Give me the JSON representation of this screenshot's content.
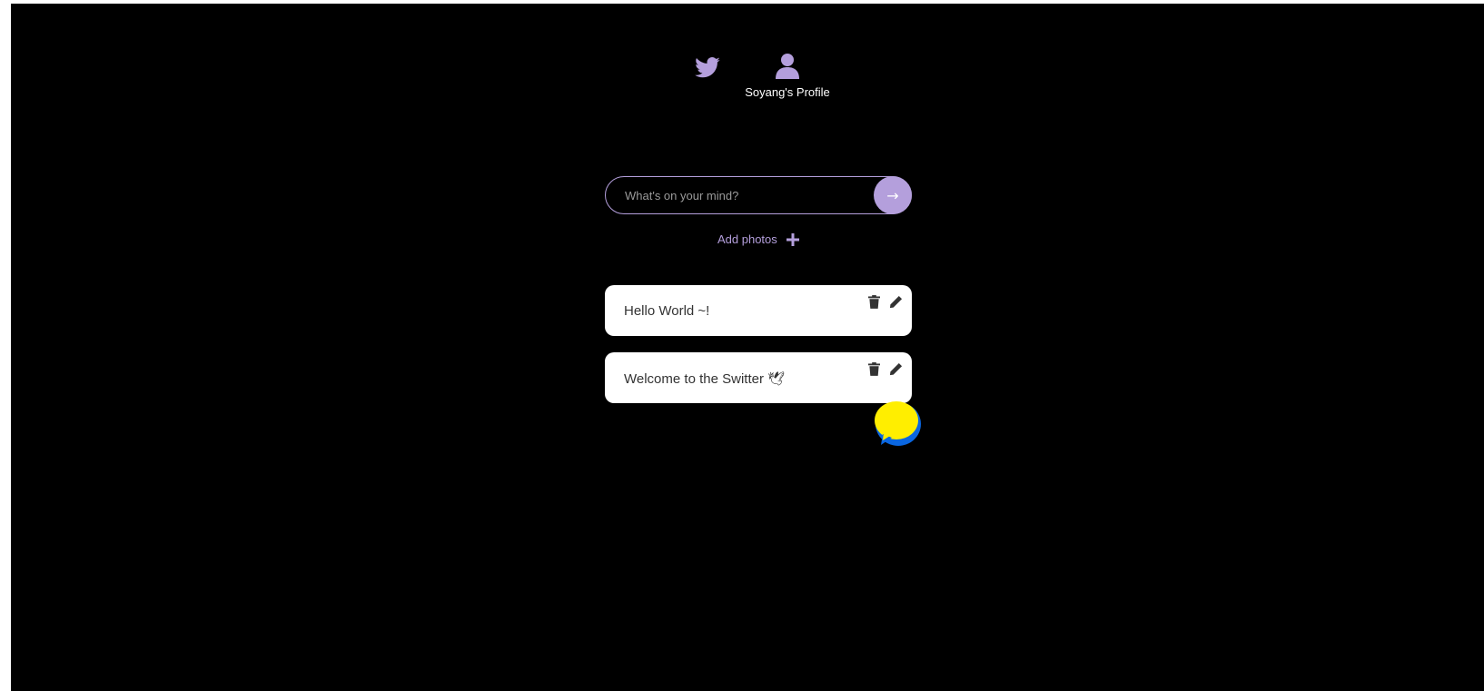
{
  "nav": {
    "home_icon": "twitter-bird-icon",
    "profile_icon": "user-icon",
    "profile_label": "Soyang's Profile"
  },
  "composer": {
    "placeholder": "What's on your mind?",
    "value": "",
    "submit_label": "→"
  },
  "add_photos": {
    "label": "Add photos",
    "icon": "plus-icon"
  },
  "tweets": [
    {
      "text": "Hello World ~!"
    },
    {
      "text": "Welcome to the Switter 🕊"
    }
  ],
  "colors": {
    "accent": "#b49fdc",
    "background": "#000000",
    "card": "#ffffff",
    "chat_bubble": "#ffee00",
    "chat_bubble_ring": "#0a66e0"
  }
}
